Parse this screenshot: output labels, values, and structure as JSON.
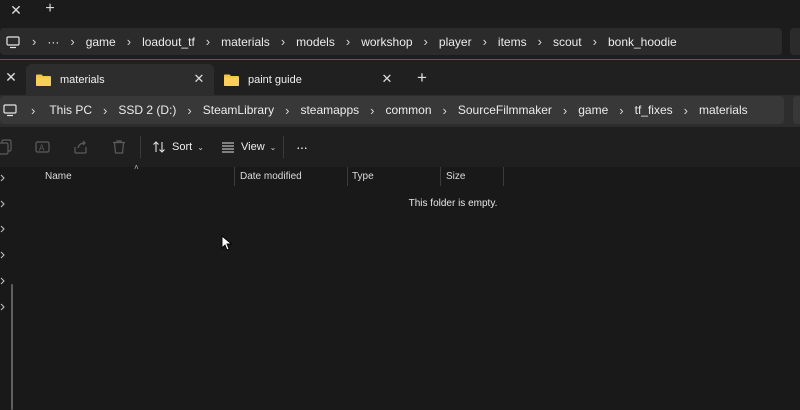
{
  "back_window": {
    "tabs": {
      "close_glyph": "✕",
      "new_tab_glyph": "+"
    },
    "address": {
      "overflow_label": "···",
      "crumbs": [
        "game",
        "loadout_tf",
        "materials",
        "models",
        "workshop",
        "player",
        "items",
        "scout",
        "bonk_hoodie"
      ]
    }
  },
  "front_window": {
    "close_glyph": "✕",
    "tabs": [
      {
        "label": "materials",
        "active": true
      },
      {
        "label": "paint guide",
        "active": false
      }
    ],
    "tab_close_glyph": "✕",
    "new_tab_glyph": "+",
    "address": {
      "crumbs": [
        "This PC",
        "SSD 2 (D:)",
        "SteamLibrary",
        "steamapps",
        "common",
        "SourceFilmmaker",
        "game",
        "tf_fixes",
        "materials"
      ]
    },
    "command_bar": {
      "sort_label": "Sort",
      "view_label": "View",
      "more_label": "···",
      "caret": "⌄"
    },
    "columns": [
      "Name",
      "Date modified",
      "Type",
      "Size"
    ],
    "empty_message": "This folder is empty."
  },
  "colors": {
    "folder_yellow": "#f4c542",
    "accent_purple": "#6b4a86"
  }
}
